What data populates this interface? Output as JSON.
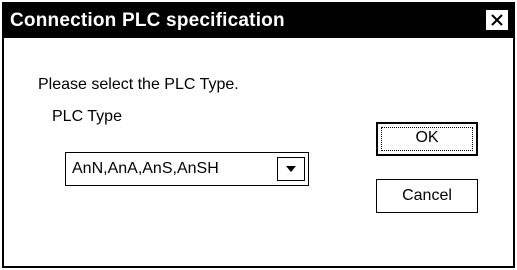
{
  "dialog": {
    "title": "Connection PLC specification",
    "close_icon": "close-x-icon",
    "prompt": "Please select the PLC Type.",
    "plc_type": {
      "label": "PLC Type",
      "selected": "AnN,AnA,AnS,AnSH",
      "arrow_icon": "chevron-down-icon"
    },
    "buttons": {
      "ok": "OK",
      "cancel": "Cancel"
    }
  }
}
